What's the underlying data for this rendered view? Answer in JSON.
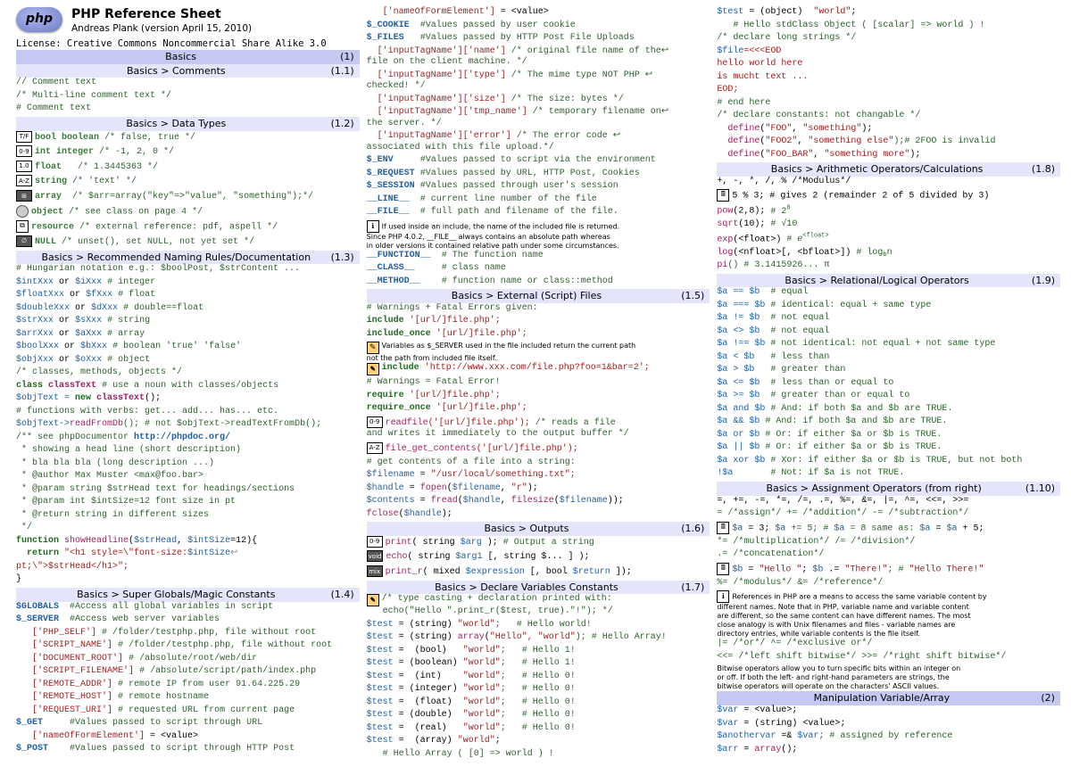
{
  "title": {
    "logo_text": "php",
    "main": "PHP Reference Sheet",
    "author": "Andreas Plank (version April 15, 2010)",
    "license": "License: Creative Commons Noncommercial Share Alike 3.0"
  },
  "headers": {
    "basics": {
      "title": "Basics",
      "num": "(1)"
    },
    "comments": {
      "title": "Basics > Comments",
      "num": "(1.1)"
    },
    "datatypes": {
      "title": "Basics > Data Types",
      "num": "(1.2)"
    },
    "naming": {
      "title": "Basics > Recommended Naming Rules/Documentation",
      "num": "(1.3)"
    },
    "superglobals": {
      "title": "Basics > Super Globals/Magic Constants",
      "num": "(1.4)"
    },
    "external": {
      "title": "Basics > External (Script) Files",
      "num": "(1.5)"
    },
    "outputs": {
      "title": "Basics > Outputs",
      "num": "(1.6)"
    },
    "declare": {
      "title": "Basics > Declare Variables Constants",
      "num": "(1.7)"
    },
    "arith": {
      "title": "Basics > Arithmetic Operators/Calculations",
      "num": "(1.8)"
    },
    "relational": {
      "title": "Basics > Relational/Logical Operators",
      "num": "(1.9)"
    },
    "assign": {
      "title": "Basics > Assignment Operators (from right)",
      "num": "(1.10)"
    },
    "manip": {
      "title": "Manipulation Variable/Array",
      "num": "(2)"
    }
  },
  "badges": {
    "tf": "T/F",
    "zero9": "0-9",
    "float": "1.0",
    "az": "A-Z",
    "arr": "⊞",
    "obj": "◉",
    "res": "⧉",
    "null": "∅",
    "note": "✎",
    "calc": "🖩",
    "info": "ℹ",
    "read": "0-9",
    "file": "A-Z"
  },
  "col1": {
    "comments": {
      "l1": "// Comment text",
      "l2": "/* Multi-line comment text */",
      "l3": "# Comment text"
    },
    "datatypes": {
      "l1a": "bool boolean",
      "l1b": "/* false, true */",
      "l2a": "int integer",
      "l2b": "/* -1, 2, 0 */",
      "l3a": "float",
      "l3b": "/* 1.3445363 */",
      "l4a": "string",
      "l4b": "/* 'text' */",
      "l5a": "array",
      "l5b": "/* $arr=array(\"key\"=>\"value\", \"something\");*/",
      "l6a": "object",
      "l6b": "/* see class",
      "l6c": "on page 4 */",
      "l7a": "resource",
      "l7b": "/* external reference: pdf, aspell */",
      "l8a": "NULL",
      "l8b": "/* unset(), set NULL, not yet set */"
    },
    "naming": {
      "hint": "# Hungarian notation e.g.: $boolPost, $strContent ...",
      "r1a": "$intXxx",
      "r1b": "or",
      "r1c": "$iXxx",
      "r1d": "# integer",
      "r2a": "$floatXxx",
      "r2b": "or",
      "r2c": "$fXxx",
      "r2d": "# float",
      "r3a": "$doubleXxx",
      "r3b": "or",
      "r3c": "$dXxx",
      "r3d": "# double==float",
      "r4a": "$strXxx",
      "r4b": "or",
      "r4c": "$sXxx",
      "r4d": "# string",
      "r5a": "$arrXxx",
      "r5b": "or",
      "r5c": "$aXxx",
      "r5d": "# array",
      "r6a": "$boolXxx",
      "r6b": "or",
      "r6c": "$bXxx",
      "r6d": "# boolean 'true' 'false'",
      "r7a": "$objXxx",
      "r7b": "or",
      "r7c": "$oXxx",
      "r7d": "# object",
      "r8": "/* classes, methods, objects */",
      "r9a": "class",
      "r9b": "classText",
      "r9c": "# use a noun with classes/objects",
      "r10a": "$objText = ",
      "r10b": "new",
      "r10c": "classText",
      "r10d": "();",
      "r11": "# functions with verbs: get... add... has... etc.",
      "r12a": "$objText->",
      "r12b": "readFromDb",
      "r12c": "(); # not $objText->readTextFromDb();",
      "doc1": "/** see phpDocumentor ",
      "docurl": "http://phpdoc.org/",
      "doc2": " * showing a head line (short description)",
      "doc3": " * bla bla bla (long description ...)",
      "doc4": " * @author Max Muster <max@foo.bar>",
      "doc5": " * @param string $strHead text for headings/sections",
      "doc6": " * @param int $intSize=12 font size in pt",
      "doc7": " * @return string in different sizes",
      "doc8": " */",
      "fn1a": "function",
      "fn1b": "showHeadline",
      "fn1c": "(",
      "fn1d": "$strHead",
      "fn1e": ", ",
      "fn1f": "$intSize",
      "fn1g": "=12){",
      "fn2a": "  return",
      "fn2b": " \"<h1 style=\\\"font-size:",
      "fn2c": "$intSize",
      "fn2d": "↩",
      "fn3": "pt;\\\">$strHead</h1>\";",
      "fn4": "}"
    },
    "super": {
      "l1a": "$GLOBALS",
      "l1b": "#Access all global variables in script",
      "l2a": "$_SERVER",
      "l2b": "#Access web server variables",
      "l3a": "['PHP_SELF']",
      "l3b": "# /folder/testphp.php, file without root",
      "l4a": "['SCRIPT_NAME']",
      "l4b": "# /folder/testphp.php, file without root",
      "l5a": "['DOCUMENT_ROOT']",
      "l5b": "# /absolute/root/web/dir",
      "l6a": "['SCRIPT_FILENAME']",
      "l6b": "# /absolute/script/path/index.php",
      "l7a": "['REMOTE_ADDR']",
      "l7b": "# remote IP from user 91.64.225.29",
      "l8a": "['REMOTE_HOST']",
      "l8b": "# remote hostname",
      "l9a": "['REQUEST_URI']",
      "l9b": "# requested URL from current page",
      "l10a": "$_GET",
      "l10b": "#Values passed to script through URL",
      "l11a": "['nameOfFormElement']",
      "l11b": " = <value>",
      "l12a": "$_POST",
      "l12b": "#Values passed to script through HTTP Post"
    }
  },
  "col2": {
    "top": {
      "l1a": "['nameOfFormElement']",
      "l1b": " = <value>",
      "l2a": "$_COOKIE",
      "l2b": "#Values passed by user cookie",
      "l3a": "$_FILES",
      "l3b": "#Values passed by HTTP Post File Uploads",
      "l4a": "['inputTagName']['name']",
      "l4b": "/* original file name of the↩\nfile on the client machine. */",
      "l5a": "['inputTagName']['type']",
      "l5b": "/* The mime type NOT PHP ↩\nchecked! */",
      "l6a": "['inputTagName']['size']",
      "l6b": "/* The size: bytes */",
      "l7a": "['inputTagName']['tmp_name']",
      "l7b": "/* temporary filename on↩\nthe server. */",
      "l8a": "['inputTagName']['error']",
      "l8b": "/* The error code ↩\nassociated with this file upload.*/",
      "l9a": "$_ENV",
      "l9b": "#Values passed to script via the environment",
      "l10a": "$_REQUEST",
      "l10b": "#Values passed by URL, HTTP Post, Cookies",
      "l11a": "$_SESSION",
      "l11b": "#Values passed through user's session",
      "l12a": "__LINE__",
      "l12b": "# current line number of the file",
      "l13a": "__FILE__",
      "l13b": "# full path and filename of the file.",
      "note1": "If used inside an include, the name of the included file is returned.\nSince PHP 4.0.2, __FILE__ always contains an absolute path whereas\nin older versions it contained relative path under some circumstances.",
      "l14a": "__FUNCTION__",
      "l14b": "# The function name",
      "l15a": "__CLASS__",
      "l15b": "# class name",
      "l16a": "__METHOD__",
      "l16b": "# function name or class::method"
    },
    "ext": {
      "l1": "# Warnings + Fatal Errors given:",
      "l2a": "include",
      "l2b": "'[url/]file.php';",
      "l3a": "include_once",
      "l3b": "'[url/]file.php';",
      "note": "Variables as $_SERVER used in the file included return the current path\nnot the path from included file itself.",
      "l4a": "include",
      "l4b": "'http://www.xxx.com/file.php?foo=1&bar=2';",
      "l5": "# Warnings = Fatal Error!",
      "l6a": "require",
      "l6b": "'[url/]file.php';",
      "l7a": "require_once",
      "l7b": "'[url/]file.php';",
      "l8a": "readfile",
      "l8b": "('[url/]file.php');",
      "l8c": "/* reads a file\nand writes it immediately to the output buffer */",
      "l9a": "file_get_contents",
      "l9b": "('[url/]file.php');",
      "l10": "# get contents of a file into a string:",
      "l11a": "$filename",
      "l11b": " = ",
      "l11c": "\"/usr/local/something.txt\";",
      "l12a": "$handle",
      "l12b": " = ",
      "l12c": "fopen",
      "l12d": "(",
      "l12e": "$filename",
      "l12f": ", ",
      "l12g": "\"r\"",
      "l12h": ");",
      "l13a": "$contents",
      "l13b": " = ",
      "l13c": "fread",
      "l13d": "(",
      "l13e": "$handle",
      "l13f": ", ",
      "l13g": "filesize",
      "l13h": "(",
      "l13i": "$filename",
      "l13j": "));",
      "l14a": "fclose",
      "l14b": "(",
      "l14c": "$handle",
      "l14d": ");"
    },
    "out": {
      "l1a": "print",
      "l1b": "( string ",
      "l1c": "$arg",
      "l1d": " );",
      "l1e": "# Output a string",
      "l2a": "echo",
      "l2b": "( string ",
      "l2c": "$arg1",
      "l2d": " [, string $... ] );",
      "l3a": "print_r",
      "l3b": "( mixed ",
      "l3c": "$expression",
      "l3d": " [, bool ",
      "l3e": "$return",
      "l3f": " ]);"
    },
    "decl": {
      "note": "/* type casting + declaration printed with:\n   echo(\"Hello \".print_r($test, true).\"!\"); */",
      "r1a": "$test",
      "r1b": " = (string) ",
      "r1c": "\"world\"",
      "r1d": ";   # Hello world!",
      "r2a": "$test",
      "r2b": " = (string) ",
      "r2c": "array",
      "r2d": "(",
      "r2e": "\"Hello\", \"world\"",
      "r2f": "); # Hello Array!",
      "r3a": "$test",
      "r3b": " =  (bool)   ",
      "r3c": "\"world\"",
      "r3d": ";   # Hello 1!",
      "r4a": "$test",
      "r4b": " = (boolean) ",
      "r4c": "\"world\"",
      "r4d": ";   # Hello 1!",
      "r5a": "$test",
      "r5b": " =  (int)    ",
      "r5c": "\"world\"",
      "r5d": ";   # Hello 0!",
      "r6a": "$test",
      "r6b": " = (integer) ",
      "r6c": "\"world\"",
      "r6d": ";   # Hello 0!",
      "r7a": "$test",
      "r7b": " =  (float)  ",
      "r7c": "\"world\"",
      "r7d": ";   # Hello 0!",
      "r8a": "$test",
      "r8b": " = (double)  ",
      "r8c": "\"world\"",
      "r8d": ";   # Hello 0!",
      "r9a": "$test",
      "r9b": " =  (real)   ",
      "r9c": "\"world\"",
      "r9d": ";   # Hello 0!",
      "r10a": "$test",
      "r10b": " =  (array) ",
      "r10c": "\"world\"",
      "r10d": ";",
      "r11": "   # Hello Array ( [0] => world ) !"
    }
  },
  "col3": {
    "top": {
      "l1a": "$test",
      "l1b": " = (object)  ",
      "l1c": "\"world\"",
      "l1d": ";",
      "l2": "   # Hello stdClass Object ( [scalar] => world ) !",
      "l3": "/* declare long strings */",
      "l4a": "$file",
      "l4b": "=<<<EOD",
      "l5": "hello world here",
      "l6": "is mucht text ...",
      "l7": "EOD;",
      "l8": "# end here",
      "l9": "/* declare constants: not changable */",
      "l10a": "define",
      "l10b": "(",
      "l10c": "\"FOO\"",
      "l10d": ", ",
      "l10e": "\"something\"",
      "l10f": ");",
      "l11a": "define",
      "l11b": "(",
      "l11c": "\"FOO2\"",
      "l11d": ", ",
      "l11e": "\"something else\"",
      "l11f": ");# 2FOO is invalid",
      "l12a": "define",
      "l12b": "(",
      "l12c": "\"FOO_BAR\"",
      "l12d": ", ",
      "l12e": "\"something more\"",
      "l12f": ");"
    },
    "arith": {
      "l1": "+, -, *, /, % /*Modulus*/",
      "l2": "5 % 3; # gives 2 (remainder 2 of 5 divided by 3)",
      "l3a": "pow",
      "l3b": "(2,8); ",
      "l3c": "# 2",
      "l3sup": "8",
      "l4a": "sqrt",
      "l4b": "(10); ",
      "l4c": "# √10",
      "l5a": "exp",
      "l5b": "(<float>) ",
      "l5c": "# ℯ",
      "l5sup": "<float>",
      "l6a": "log",
      "l6b": "(<nfloat>[, <bfloat>]) ",
      "l6c": "# log",
      "l6sub": "b",
      "l6d": "n",
      "l7a": "pi",
      "l7b": "() # 3.1415926... π"
    },
    "rel": {
      "r1a": "$a == $b",
      "r1b": "# equal",
      "r2a": "$a === $b",
      "r2b": "# identical: equal + same type",
      "r3a": "$a != $b",
      "r3b": "# not equal",
      "r4a": "$a <> $b",
      "r4b": "# not equal",
      "r5a": "$a !== $b",
      "r5b": "# not identical: not equal + not same type",
      "r6a": "$a < $b",
      "r6b": "# less than",
      "r7a": "$a > $b",
      "r7b": "# greater than",
      "r8a": "$a <= $b",
      "r8b": "# less than or equal to",
      "r9a": "$a >= $b",
      "r9b": "# greater than or equal to",
      "r10a": "$a and $b",
      "r10b": "# And: if both $a and $b are TRUE.",
      "r11a": "$a && $b",
      "r11b": "# And: if both $a and $b are TRUE.",
      "r12a": "$a or $b",
      "r12b": "# Or: if either $a or $b is TRUE.",
      "r13a": "$a || $b",
      "r13b": "# Or: if either $a or $b is TRUE.",
      "r14a": "$a xor $b",
      "r14b": "# Xor: if either $a or $b is TRUE, but not both",
      "r15a": "!$a",
      "r15b": "# Not: if $a is not TRUE."
    },
    "assign": {
      "l1": "=, +=, -=, *=, /=, .=, %=, &=, |=, ^=, <<=, >>=",
      "l2": "= /*assign*/ += /*addition*/ -= /*subtraction*/",
      "l3a": "$a",
      "l3b": " = 3; ",
      "l3c": "$a",
      "l3d": " += 5; # ",
      "l3e": "$a",
      "l3f": " = 8 same as: ",
      "l3g": "$a",
      "l3h": " = ",
      "l3i": "$a",
      "l3j": " + 5;",
      "l4": "*= /*multiplication*/ /= /*division*/",
      "l5": ".= /*concatenation*/",
      "l6a": "$b",
      "l6b": " = ",
      "l6c": "\"Hello \"",
      "l6d": "; ",
      "l6e": "$b",
      "l6f": " .= ",
      "l6g": "\"There!\"",
      "l6h": "; # ",
      "l6i": "\"Hello There!\"",
      "l7": "%= /*modulus*/ &= /*reference*/",
      "note": "References in PHP are a means to access the same variable content by\ndifferent names. Note that in PHP, variable name and variable content\nare different, so the same content can have different names. The most\nclose analogy is with Unix filenames and files - variable names are\ndirectory entries, while variable contents is the file itself.",
      "l8": "|= /*or*/ ^= /*exclusive or*/",
      "l9": "<<= /*left shift bitwise*/ >>= /*right shift bitwise*/",
      "note2": "Bitwise operators allow you to turn specific bits within an integer on\nor off. If both the left- and right-hand parameters are strings, the\nbitwise operators will operate on the characters' ASCII values."
    },
    "manip": {
      "l1a": "$var",
      "l1b": " = <value>;",
      "l2a": "$var",
      "l2b": " = (string) <value>;",
      "l3a": "$anothervar",
      "l3b": " =& ",
      "l3c": "$var",
      "l3d": "; # assigned by reference",
      "l4a": "$arr",
      "l4b": " = ",
      "l4c": "array",
      "l4d": "();"
    }
  }
}
